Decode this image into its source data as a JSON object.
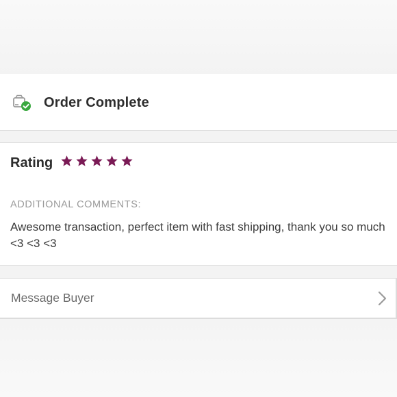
{
  "order": {
    "title": "Order Complete",
    "icon": "package-check-icon"
  },
  "rating": {
    "label": "Rating",
    "stars": 5,
    "max_stars": 5,
    "star_color": "#7a1a55"
  },
  "comments": {
    "heading": "ADDITIONAL COMMENTS:",
    "text": "Awesome transaction, perfect item with fast shipping, thank you so much <3 <3 <3"
  },
  "message_buyer": {
    "label": "Message Buyer",
    "icon": "chevron-right-icon"
  },
  "colors": {
    "check_green": "#39a83f",
    "icon_gray": "#9a9a9a",
    "background": "#f3f3f3"
  }
}
